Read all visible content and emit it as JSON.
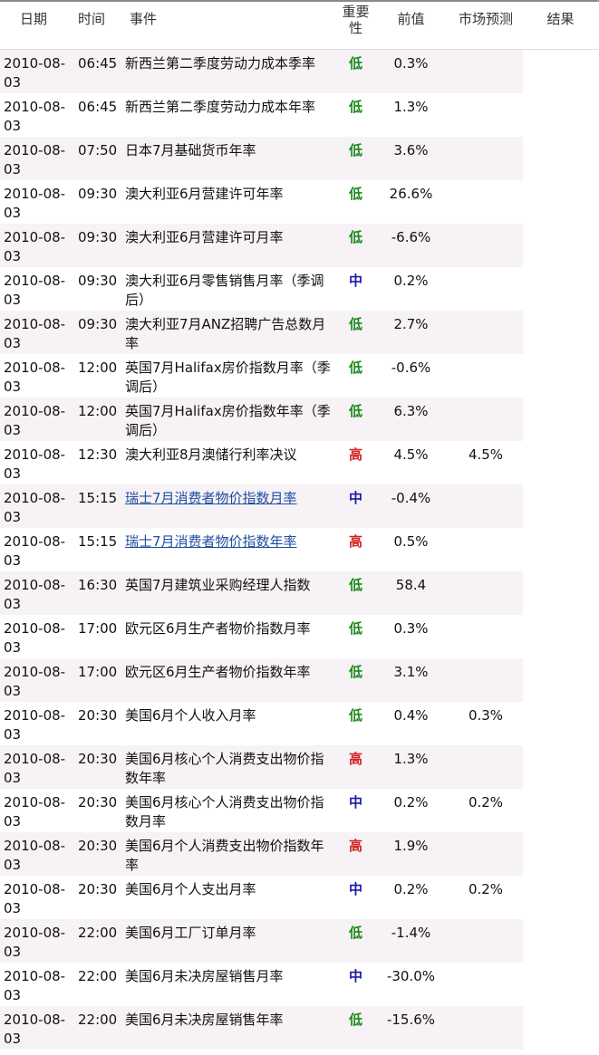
{
  "columns": {
    "date": "日期",
    "time": "时间",
    "event": "事件",
    "importance": "重要性",
    "previous": "前值",
    "forecast": "市场预测",
    "result": "结果"
  },
  "importance_colors": {
    "低": "#1a8a1a",
    "中": "#1a1aa8",
    "高": "#d42020"
  },
  "rows": [
    {
      "date": "2010-08-03",
      "time": "06:45",
      "event": "新西兰第二季度劳动力成本季率",
      "importance": "低",
      "previous": "0.3%",
      "forecast": "",
      "result": "",
      "link": false
    },
    {
      "date": "2010-08-03",
      "time": "06:45",
      "event": "新西兰第二季度劳动力成本年率",
      "importance": "低",
      "previous": "1.3%",
      "forecast": "",
      "result": "",
      "link": false
    },
    {
      "date": "2010-08-03",
      "time": "07:50",
      "event": "日本7月基础货币年率",
      "importance": "低",
      "previous": "3.6%",
      "forecast": "",
      "result": "",
      "link": false
    },
    {
      "date": "2010-08-03",
      "time": "09:30",
      "event": "澳大利亚6月营建许可年率",
      "importance": "低",
      "previous": "26.6%",
      "forecast": "",
      "result": "",
      "link": false
    },
    {
      "date": "2010-08-03",
      "time": "09:30",
      "event": "澳大利亚6月营建许可月率",
      "importance": "低",
      "previous": "-6.6%",
      "forecast": "",
      "result": "",
      "link": false
    },
    {
      "date": "2010-08-03",
      "time": "09:30",
      "event": "澳大利亚6月零售销售月率（季调后）",
      "importance": "中",
      "previous": "0.2%",
      "forecast": "",
      "result": "",
      "link": false
    },
    {
      "date": "2010-08-03",
      "time": "09:30",
      "event": "澳大利亚7月ANZ招聘广告总数月率",
      "importance": "低",
      "previous": "2.7%",
      "forecast": "",
      "result": "",
      "link": false
    },
    {
      "date": "2010-08-03",
      "time": "12:00",
      "event": "英国7月Halifax房价指数月率（季调后）",
      "importance": "低",
      "previous": "-0.6%",
      "forecast": "",
      "result": "",
      "link": false
    },
    {
      "date": "2010-08-03",
      "time": "12:00",
      "event": "英国7月Halifax房价指数年率（季调后）",
      "importance": "低",
      "previous": "6.3%",
      "forecast": "",
      "result": "",
      "link": false
    },
    {
      "date": "2010-08-03",
      "time": "12:30",
      "event": "澳大利亚8月澳储行利率决议",
      "importance": "高",
      "previous": "4.5%",
      "forecast": "4.5%",
      "result": "",
      "link": false
    },
    {
      "date": "2010-08-03",
      "time": "15:15",
      "event": "瑞士7月消费者物价指数月率",
      "importance": "中",
      "previous": "-0.4%",
      "forecast": "",
      "result": "",
      "link": true
    },
    {
      "date": "2010-08-03",
      "time": "15:15",
      "event": "瑞士7月消费者物价指数年率",
      "importance": "高",
      "previous": "0.5%",
      "forecast": "",
      "result": "",
      "link": true
    },
    {
      "date": "2010-08-03",
      "time": "16:30",
      "event": "英国7月建筑业采购经理人指数",
      "importance": "低",
      "previous": "58.4",
      "forecast": "",
      "result": "",
      "link": false
    },
    {
      "date": "2010-08-03",
      "time": "17:00",
      "event": "欧元区6月生产者物价指数月率",
      "importance": "低",
      "previous": "0.3%",
      "forecast": "",
      "result": "",
      "link": false
    },
    {
      "date": "2010-08-03",
      "time": "17:00",
      "event": "欧元区6月生产者物价指数年率",
      "importance": "低",
      "previous": "3.1%",
      "forecast": "",
      "result": "",
      "link": false
    },
    {
      "date": "2010-08-03",
      "time": "20:30",
      "event": "美国6月个人收入月率",
      "importance": "低",
      "previous": "0.4%",
      "forecast": "0.3%",
      "result": "",
      "link": false
    },
    {
      "date": "2010-08-03",
      "time": "20:30",
      "event": "美国6月核心个人消费支出物价指数年率",
      "importance": "高",
      "previous": "1.3%",
      "forecast": "",
      "result": "",
      "link": false
    },
    {
      "date": "2010-08-03",
      "time": "20:30",
      "event": "美国6月核心个人消费支出物价指数月率",
      "importance": "中",
      "previous": "0.2%",
      "forecast": "0.2%",
      "result": "",
      "link": false
    },
    {
      "date": "2010-08-03",
      "time": "20:30",
      "event": "美国6月个人消费支出物价指数年率",
      "importance": "高",
      "previous": "1.9%",
      "forecast": "",
      "result": "",
      "link": false
    },
    {
      "date": "2010-08-03",
      "time": "20:30",
      "event": "美国6月个人支出月率",
      "importance": "中",
      "previous": "0.2%",
      "forecast": "0.2%",
      "result": "",
      "link": false
    },
    {
      "date": "2010-08-03",
      "time": "22:00",
      "event": "美国6月工厂订单月率",
      "importance": "低",
      "previous": "-1.4%",
      "forecast": "",
      "result": "",
      "link": false
    },
    {
      "date": "2010-08-03",
      "time": "22:00",
      "event": "美国6月未决房屋销售月率",
      "importance": "中",
      "previous": "-30.0%",
      "forecast": "",
      "result": "",
      "link": false
    },
    {
      "date": "2010-08-03",
      "time": "22:00",
      "event": "美国6月未决房屋销售年率",
      "importance": "低",
      "previous": "-15.6%",
      "forecast": "",
      "result": "",
      "link": false
    }
  ]
}
